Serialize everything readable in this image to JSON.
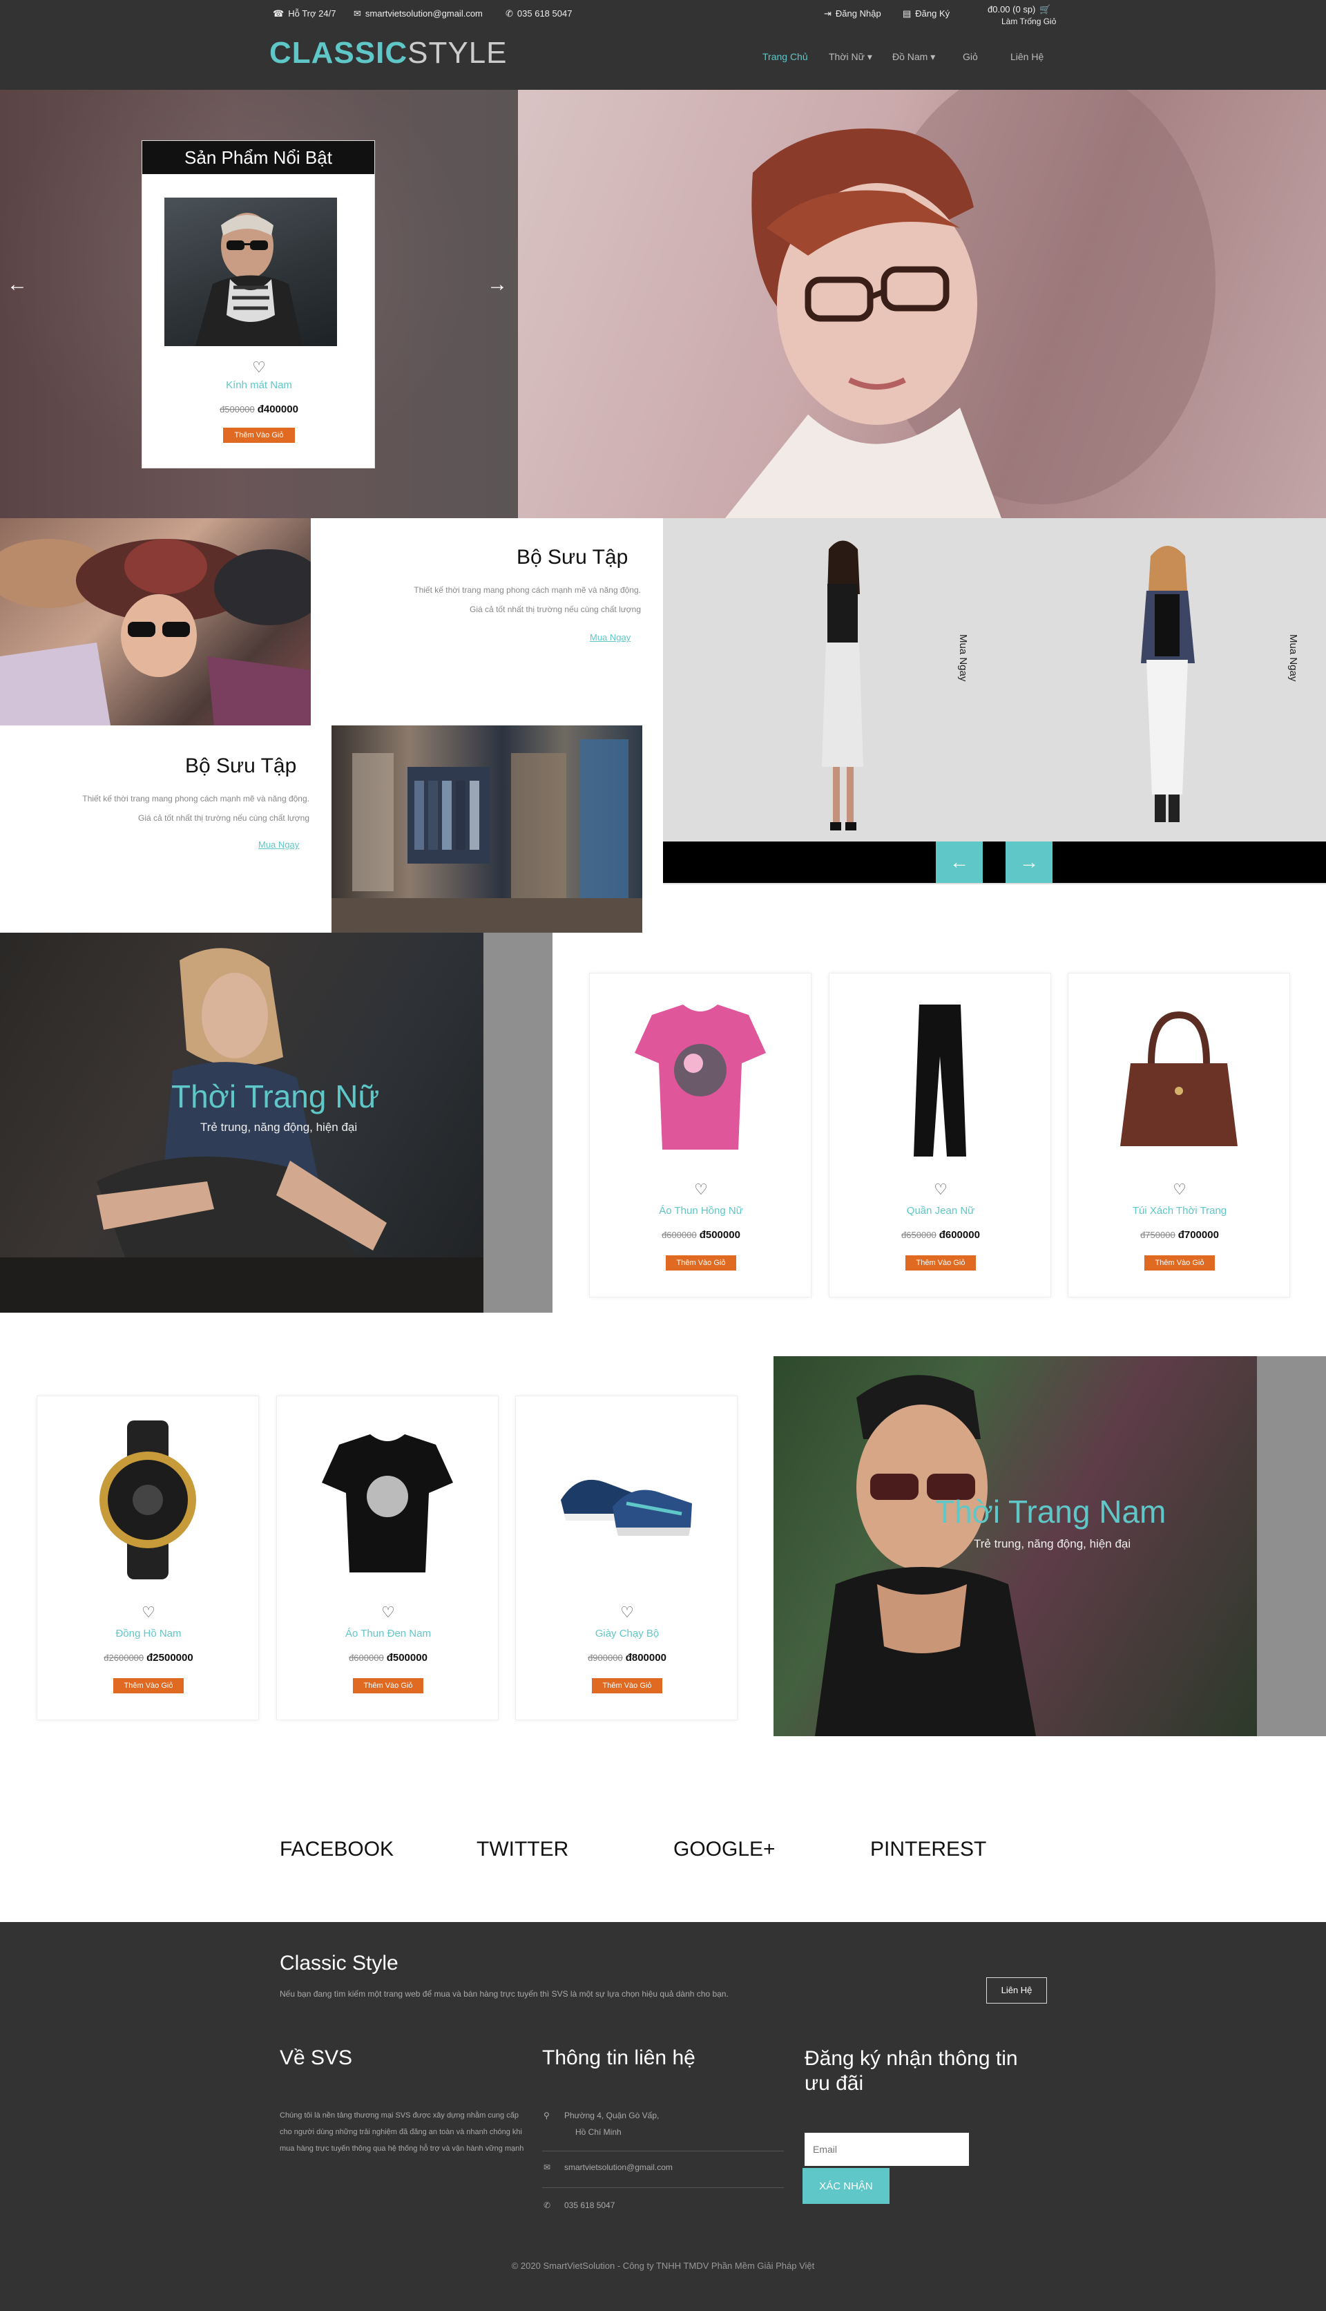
{
  "topbar": {
    "support": "Hỗ Trợ 24/7",
    "email": "smartvietsolution@gmail.com",
    "phone": "035 618 5047",
    "login": "Đăng Nhập",
    "register": "Đăng Ký",
    "cart_total": "đ0.00 (0 sp)",
    "cart_sub": "Làm Trống Giỏ"
  },
  "logo": {
    "part1": "CLASSIC",
    "part2": "STYLE"
  },
  "nav": {
    "home": "Trang Chủ",
    "women": "Thời Nữ",
    "men": "Đồ Nam",
    "cart": "Giỏ",
    "contact": "Liên Hệ"
  },
  "featured": {
    "title": "Sản Phẩm Nổi Bật",
    "product_name": "Kính mát Nam",
    "old_price": "đ500000",
    "price": "đ400000",
    "add_button": "Thêm Vào Giỏ",
    "prev": "←",
    "next": "→"
  },
  "collections": {
    "c1": {
      "title": "Bộ Sưu Tập",
      "desc1": "Thiết kế thời trang mang phong cách mạnh mẽ và năng động.",
      "desc2": "Giá cả tốt nhất thị trường nếu cùng chất lượng",
      "link": "Mua Ngay"
    },
    "c2": {
      "title": "Bộ Sưu Tập",
      "desc1": "Thiết kế thời trang mang phong cách mạnh mẽ và năng động.",
      "desc2": "Giá cả tốt nhất thị trường nếu cùng chất lượng",
      "link": "Mua Ngay"
    }
  },
  "slider": {
    "buy1": "Mua Ngay",
    "buy2": "Mua Ngay",
    "prev": "←",
    "next": "→"
  },
  "women": {
    "title": "Thời Trang Nữ",
    "subtitle": "Trẻ trung, năng động, hiện đại",
    "products": [
      {
        "name": "Áo Thun Hồng Nữ",
        "old_price": "đ600000",
        "price": "đ500000",
        "button": "Thêm Vào Giỏ"
      },
      {
        "name": "Quần Jean Nữ",
        "old_price": "đ650000",
        "price": "đ600000",
        "button": "Thêm Vào Giỏ"
      },
      {
        "name": "Túi Xách Thời Trang",
        "old_price": "đ750000",
        "price": "đ700000",
        "button": "Thêm Vào Giỏ"
      }
    ]
  },
  "men": {
    "title": "Thời Trang Nam",
    "subtitle": "Trẻ trung, năng động, hiện đại",
    "products": [
      {
        "name": "Đồng Hồ Nam",
        "old_price": "đ2600000",
        "price": "đ2500000",
        "button": "Thêm Vào Giỏ"
      },
      {
        "name": "Áo Thun Đen Nam",
        "old_price": "đ600000",
        "price": "đ500000",
        "button": "Thêm Vào Giỏ"
      },
      {
        "name": "Giày Chạy Bộ",
        "old_price": "đ900000",
        "price": "đ800000",
        "button": "Thêm Vào Giỏ"
      }
    ]
  },
  "social": {
    "facebook": "FACEBOOK",
    "twitter": "TWITTER",
    "google": "GOOGLE+",
    "pinterest": "PINTEREST"
  },
  "footer": {
    "brand": "Classic Style",
    "intro": "Nếu bạn đang tìm kiếm một trang web để mua và bán hàng trực tuyến thì SVS là một sự lựa chọn hiệu quả dành cho bạn.",
    "contact_button": "Liên Hệ",
    "about_title": "Về SVS",
    "about_text": "Chúng tôi là nền tảng thương mại SVS được xây dựng nhằm cung cấp cho người dùng những trải nghiệm đã đăng an toàn và nhanh chóng khi mua hàng trực tuyến thông qua hệ thống hỗ trợ và vận hành vững mạnh",
    "contact_title": "Thông tin liên hệ",
    "address_line1": "Phường 4, Quận Gò Vấp,",
    "address_line2": "Hồ Chí Minh",
    "email": "smartvietsolution@gmail.com",
    "phone": "035 618 5047",
    "newsletter_title_1": "Đăng ký nhận thông tin",
    "newsletter_title_2": "ưu đãi",
    "email_placeholder": "Email",
    "subscribe_button": "XÁC NHẬN",
    "copyright": "© 2020 SmartVietSolution - Công ty TNHH TMDV Phần Mềm Giải Pháp Việt"
  },
  "colors": {
    "accent": "#5fc7c7",
    "button": "#e06a21",
    "dark": "#333333"
  }
}
